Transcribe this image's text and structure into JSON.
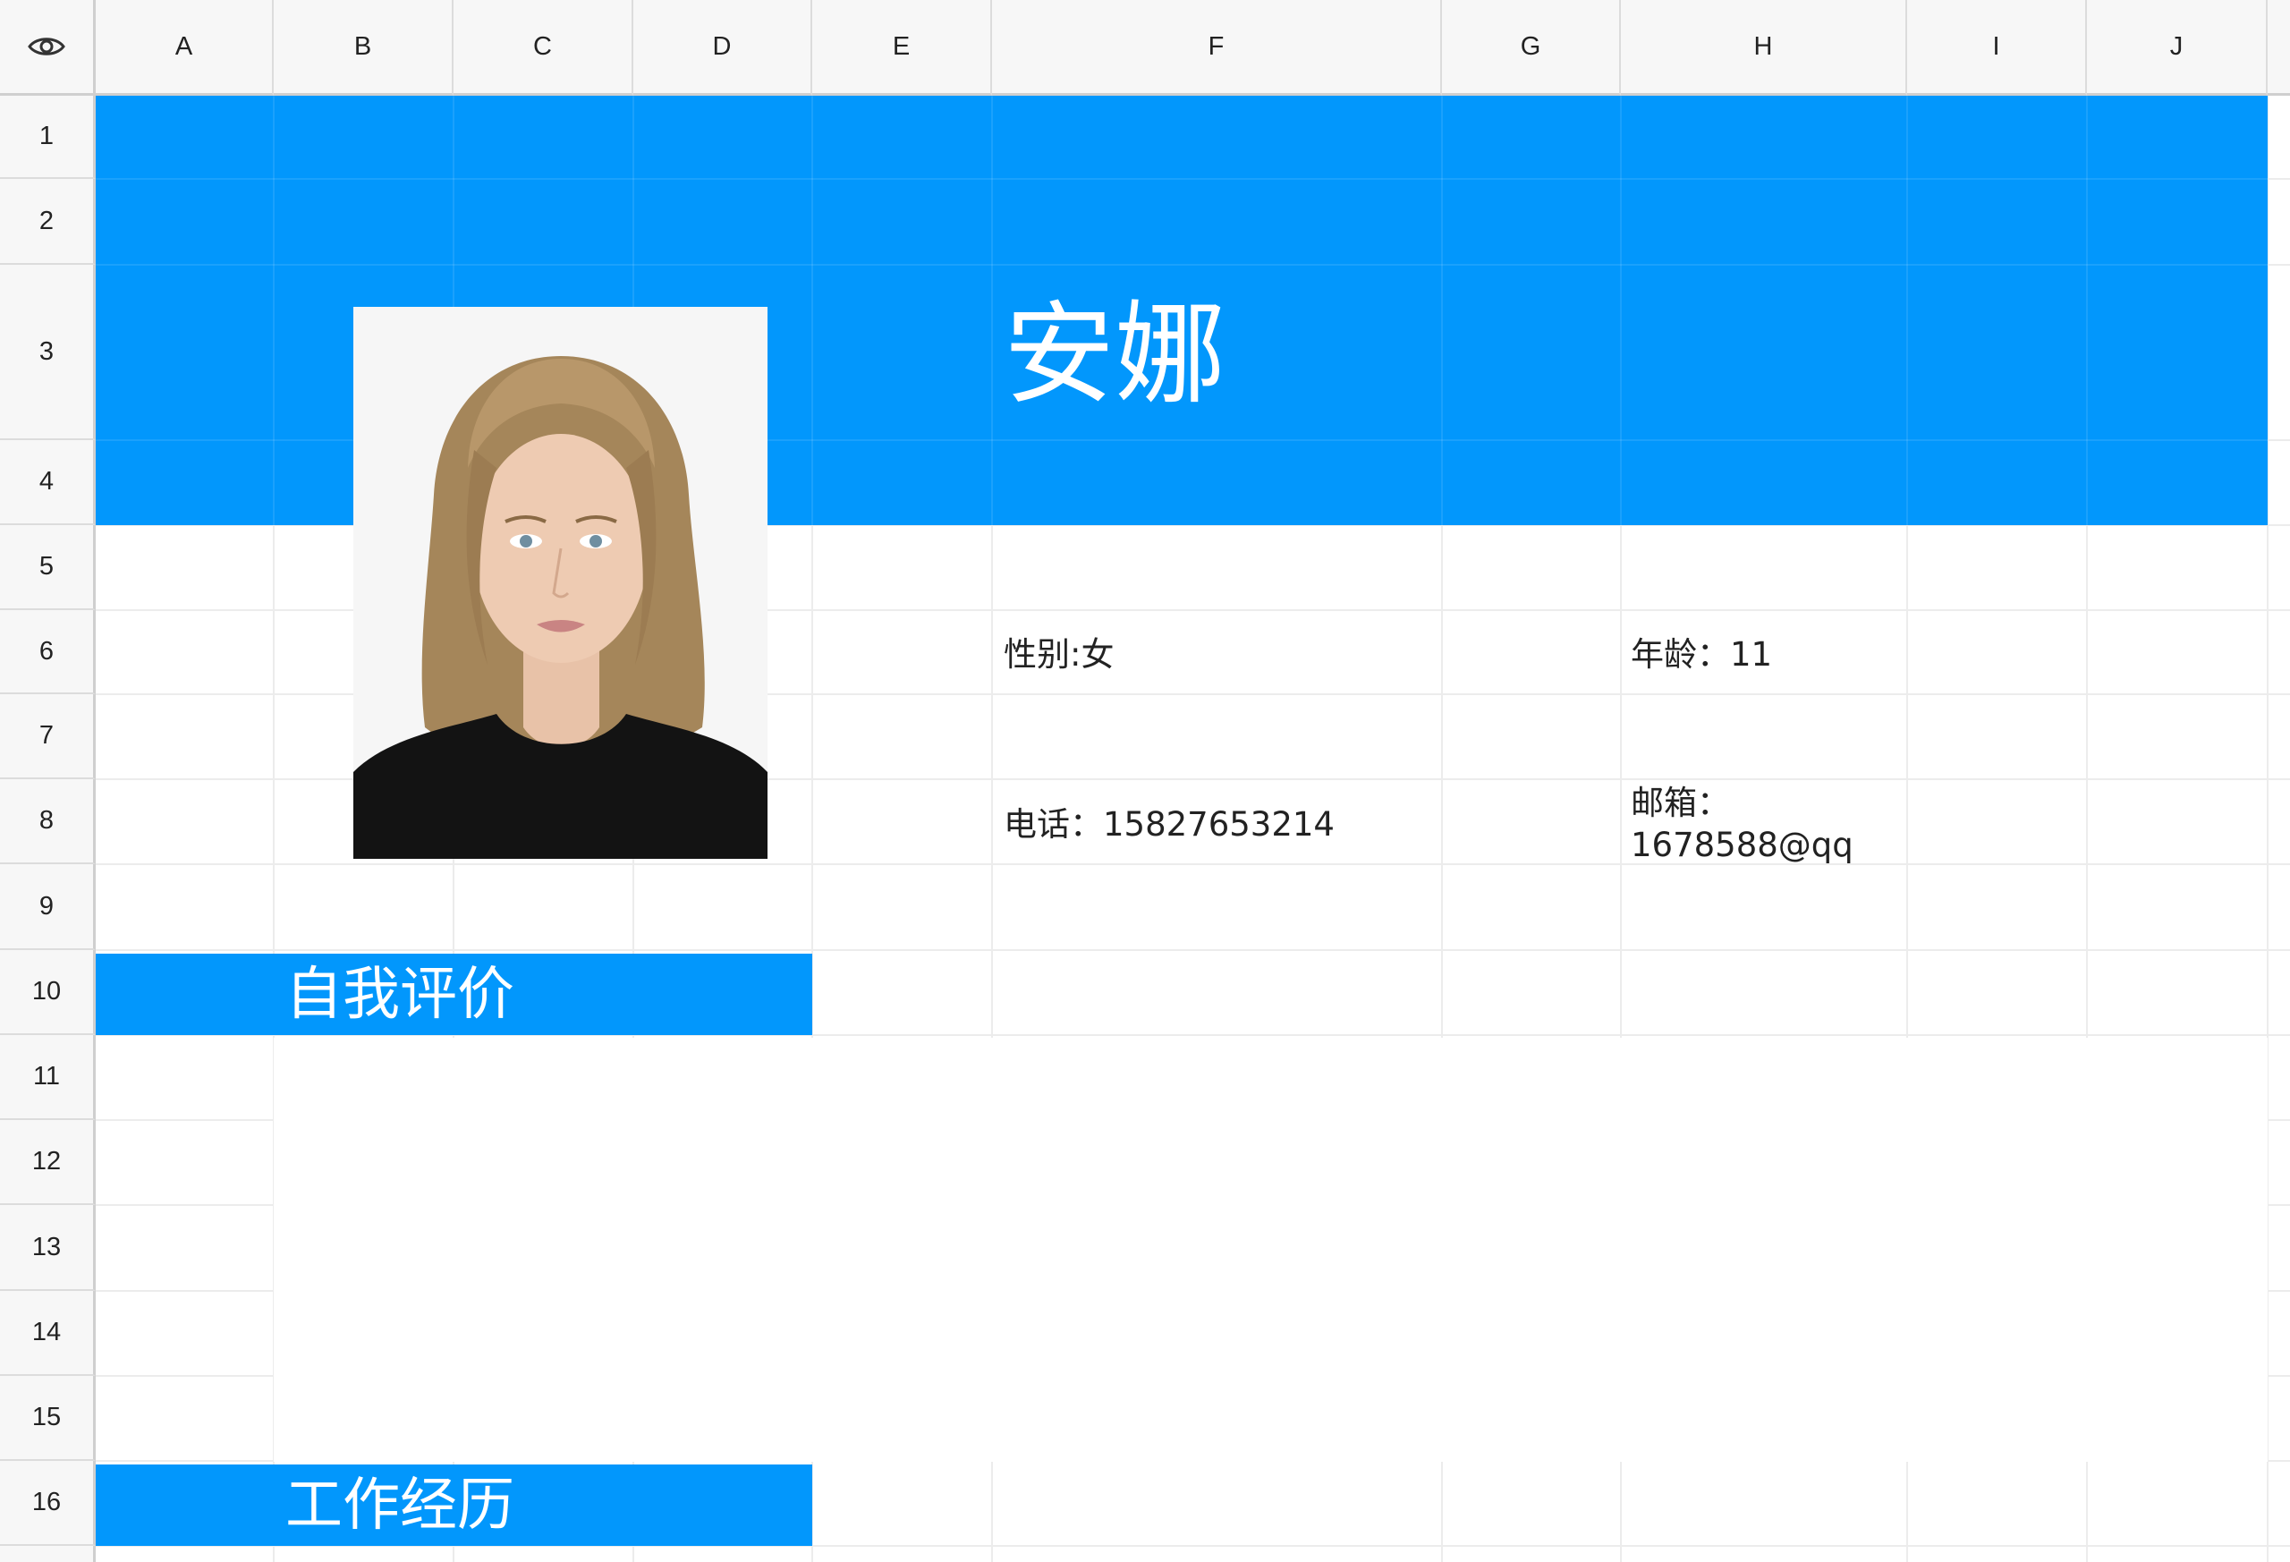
{
  "sheet": {
    "columns": [
      "A",
      "B",
      "C",
      "D",
      "E",
      "F",
      "G",
      "H",
      "I",
      "J"
    ],
    "rows": [
      "1",
      "2",
      "3",
      "4",
      "5",
      "6",
      "7",
      "8",
      "9",
      "10",
      "11",
      "12",
      "13",
      "14",
      "15",
      "16"
    ],
    "corner_icon": "eye-icon"
  },
  "resume": {
    "name": "安娜",
    "gender": "性别:女",
    "age": "年龄：11",
    "phone": "电话：15827653214",
    "email_label": "邮箱：",
    "email_value": "1678588@qq",
    "section_self_eval": "自我评价",
    "section_work": "工作经历"
  },
  "colors": {
    "accent": "#0297fc",
    "header_bg": "#f7f7f7",
    "grid": "#ececec"
  }
}
